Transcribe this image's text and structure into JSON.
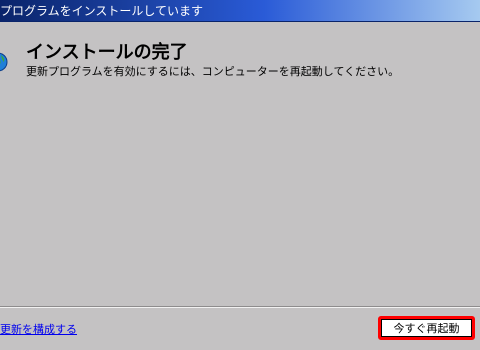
{
  "window": {
    "title": "プログラムをインストールしています"
  },
  "header": {
    "title": "インストールの完了",
    "message": "更新プログラムを有効にするには、コンピューターを再起動してください。",
    "icon": "windows-update-globe-icon"
  },
  "footer": {
    "link_label": "更新を構成する",
    "restart_label": "今すぐ再起動"
  },
  "colors": {
    "dialog_background": "#c4c2c3",
    "title_bar": "#0a246a",
    "link": "#0000ee",
    "highlight": "#ff0000"
  }
}
